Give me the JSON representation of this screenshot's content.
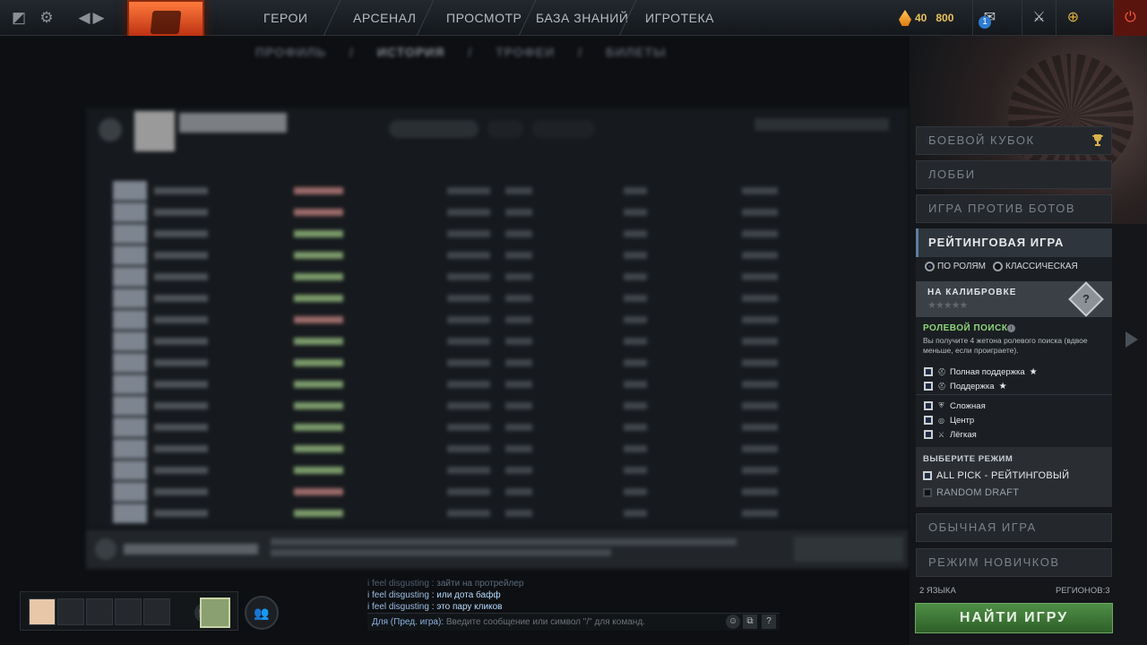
{
  "topbar": {
    "nav": [
      "ГЕРОИ",
      "АРСЕНАЛ",
      "ПРОСМОТР",
      "БАЗА ЗНАНИЙ",
      "ИГРОТЕКА"
    ],
    "shards": "40",
    "gold": "800",
    "messages_badge": "1"
  },
  "main": {
    "subnav": [
      "ПРОФИЛЬ",
      "/",
      "ИСТОРИЯ",
      "/",
      "ТРОФЕИ",
      "/",
      "БИЛЕТЫ"
    ]
  },
  "party": {
    "friends_icon": "group-icon"
  },
  "chat": {
    "lines": [
      {
        "who": "i feel disgusting",
        "msg": ": зайти на протрейлер"
      },
      {
        "who": "i feel disgusting",
        "msg": ": или дота бафф"
      },
      {
        "who": "i feel disgusting",
        "msg": ": это пару кликов"
      }
    ],
    "target": "Для (Пред. игра):",
    "placeholder": "Введите сообщение или символ \"/\" для команд.",
    "help": "?"
  },
  "right_panel": {
    "battle_cup": "БОЕВОЙ КУБОК",
    "lobby": "ЛОББИ",
    "bots": "ИГРА ПРОТИВ БОТОВ",
    "ranked": {
      "title": "РЕЙТИНГОВАЯ ИГРА",
      "by_roles": "ПО РОЛЯМ",
      "classic": "КЛАССИЧЕСКАЯ",
      "calibration": "НА КАЛИБРОВКЕ",
      "stars": "★★★★★",
      "medal_mark": "?",
      "role_search_title": "РОЛЕВОЙ ПОИСК",
      "role_search_desc": "Вы получите 4 жетона ролевого поиска (вдвое меньше, если проиграете).",
      "roles": [
        "Полная поддержка",
        "Поддержка",
        "Сложная",
        "Центр",
        "Лёгкая"
      ],
      "select_mode": "ВЫБЕРИТЕ РЕЖИМ",
      "modes": [
        "ALL PICK - РЕЙТИНГОВЫЙ",
        "RANDOM DRAFT"
      ]
    },
    "normal": "ОБЫЧНАЯ ИГРА",
    "beginner": "РЕЖИМ НОВИЧКОВ",
    "languages": "2 ЯЗЫКА",
    "regions": "РЕГИОНОВ:3",
    "find_game": "НАЙТИ ИГРУ"
  }
}
